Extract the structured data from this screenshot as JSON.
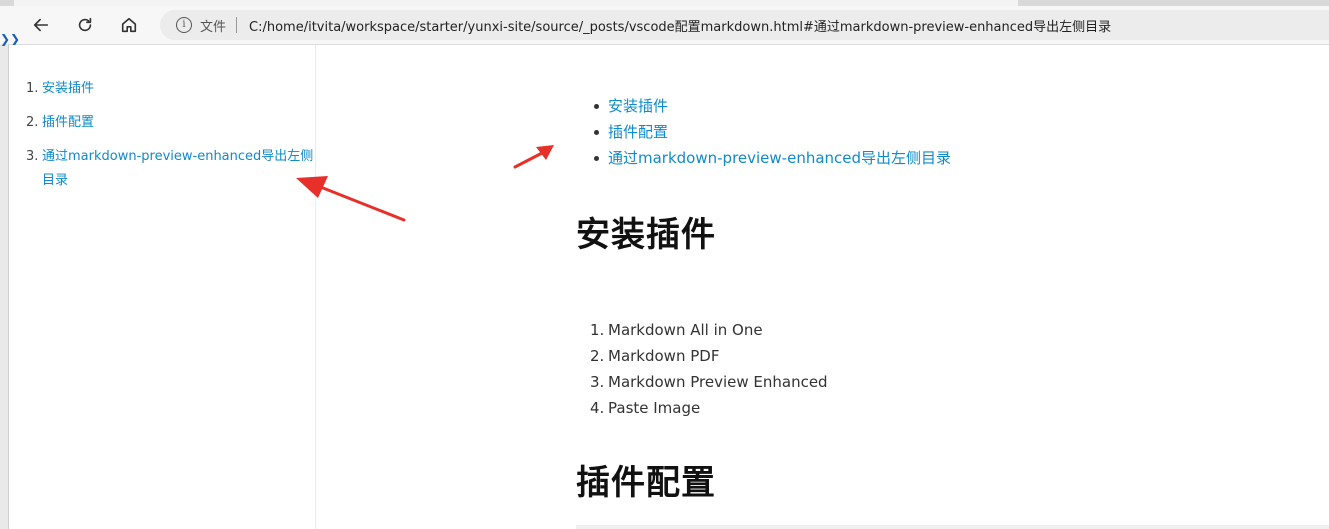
{
  "browser": {
    "file_label": "文件",
    "url": "C:/home/itvita/workspace/starter/yunxi-site/source/_posts/vscode配置markdown.html#通过markdown-preview-enhanced导出左侧目录",
    "edge_mark": "❯❯"
  },
  "sidebar": {
    "items": [
      {
        "num": "1.",
        "label": "安装插件"
      },
      {
        "num": "2.",
        "label": "插件配置"
      },
      {
        "num": "3.",
        "label": "通过markdown-preview-enhanced导出左侧目录"
      }
    ]
  },
  "content": {
    "toc": [
      "安装插件",
      "插件配置",
      "通过markdown-preview-enhanced导出左侧目录"
    ],
    "heading1": "安装插件",
    "plugins": [
      {
        "num": "1.",
        "label": "Markdown All in One"
      },
      {
        "num": "2.",
        "label": "Markdown PDF"
      },
      {
        "num": "3.",
        "label": "Markdown Preview Enhanced"
      },
      {
        "num": "4.",
        "label": "Paste Image"
      }
    ],
    "heading2": "插件配置"
  },
  "colors": {
    "link": "#0f8bc7",
    "annotation_arrow": "#e8302a"
  }
}
